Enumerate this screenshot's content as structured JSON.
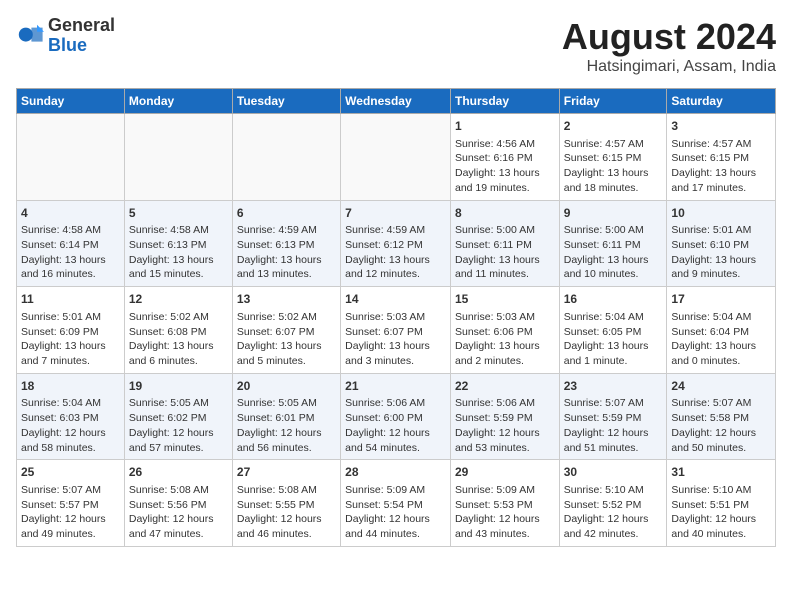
{
  "header": {
    "logo_general": "General",
    "logo_blue": "Blue",
    "title": "August 2024",
    "subtitle": "Hatsingimari, Assam, India"
  },
  "weekdays": [
    "Sunday",
    "Monday",
    "Tuesday",
    "Wednesday",
    "Thursday",
    "Friday",
    "Saturday"
  ],
  "weeks": [
    [
      {
        "day": "",
        "text": ""
      },
      {
        "day": "",
        "text": ""
      },
      {
        "day": "",
        "text": ""
      },
      {
        "day": "",
        "text": ""
      },
      {
        "day": "1",
        "text": "Sunrise: 4:56 AM\nSunset: 6:16 PM\nDaylight: 13 hours\nand 19 minutes."
      },
      {
        "day": "2",
        "text": "Sunrise: 4:57 AM\nSunset: 6:15 PM\nDaylight: 13 hours\nand 18 minutes."
      },
      {
        "day": "3",
        "text": "Sunrise: 4:57 AM\nSunset: 6:15 PM\nDaylight: 13 hours\nand 17 minutes."
      }
    ],
    [
      {
        "day": "4",
        "text": "Sunrise: 4:58 AM\nSunset: 6:14 PM\nDaylight: 13 hours\nand 16 minutes."
      },
      {
        "day": "5",
        "text": "Sunrise: 4:58 AM\nSunset: 6:13 PM\nDaylight: 13 hours\nand 15 minutes."
      },
      {
        "day": "6",
        "text": "Sunrise: 4:59 AM\nSunset: 6:13 PM\nDaylight: 13 hours\nand 13 minutes."
      },
      {
        "day": "7",
        "text": "Sunrise: 4:59 AM\nSunset: 6:12 PM\nDaylight: 13 hours\nand 12 minutes."
      },
      {
        "day": "8",
        "text": "Sunrise: 5:00 AM\nSunset: 6:11 PM\nDaylight: 13 hours\nand 11 minutes."
      },
      {
        "day": "9",
        "text": "Sunrise: 5:00 AM\nSunset: 6:11 PM\nDaylight: 13 hours\nand 10 minutes."
      },
      {
        "day": "10",
        "text": "Sunrise: 5:01 AM\nSunset: 6:10 PM\nDaylight: 13 hours\nand 9 minutes."
      }
    ],
    [
      {
        "day": "11",
        "text": "Sunrise: 5:01 AM\nSunset: 6:09 PM\nDaylight: 13 hours\nand 7 minutes."
      },
      {
        "day": "12",
        "text": "Sunrise: 5:02 AM\nSunset: 6:08 PM\nDaylight: 13 hours\nand 6 minutes."
      },
      {
        "day": "13",
        "text": "Sunrise: 5:02 AM\nSunset: 6:07 PM\nDaylight: 13 hours\nand 5 minutes."
      },
      {
        "day": "14",
        "text": "Sunrise: 5:03 AM\nSunset: 6:07 PM\nDaylight: 13 hours\nand 3 minutes."
      },
      {
        "day": "15",
        "text": "Sunrise: 5:03 AM\nSunset: 6:06 PM\nDaylight: 13 hours\nand 2 minutes."
      },
      {
        "day": "16",
        "text": "Sunrise: 5:04 AM\nSunset: 6:05 PM\nDaylight: 13 hours\nand 1 minute."
      },
      {
        "day": "17",
        "text": "Sunrise: 5:04 AM\nSunset: 6:04 PM\nDaylight: 13 hours\nand 0 minutes."
      }
    ],
    [
      {
        "day": "18",
        "text": "Sunrise: 5:04 AM\nSunset: 6:03 PM\nDaylight: 12 hours\nand 58 minutes."
      },
      {
        "day": "19",
        "text": "Sunrise: 5:05 AM\nSunset: 6:02 PM\nDaylight: 12 hours\nand 57 minutes."
      },
      {
        "day": "20",
        "text": "Sunrise: 5:05 AM\nSunset: 6:01 PM\nDaylight: 12 hours\nand 56 minutes."
      },
      {
        "day": "21",
        "text": "Sunrise: 5:06 AM\nSunset: 6:00 PM\nDaylight: 12 hours\nand 54 minutes."
      },
      {
        "day": "22",
        "text": "Sunrise: 5:06 AM\nSunset: 5:59 PM\nDaylight: 12 hours\nand 53 minutes."
      },
      {
        "day": "23",
        "text": "Sunrise: 5:07 AM\nSunset: 5:59 PM\nDaylight: 12 hours\nand 51 minutes."
      },
      {
        "day": "24",
        "text": "Sunrise: 5:07 AM\nSunset: 5:58 PM\nDaylight: 12 hours\nand 50 minutes."
      }
    ],
    [
      {
        "day": "25",
        "text": "Sunrise: 5:07 AM\nSunset: 5:57 PM\nDaylight: 12 hours\nand 49 minutes."
      },
      {
        "day": "26",
        "text": "Sunrise: 5:08 AM\nSunset: 5:56 PM\nDaylight: 12 hours\nand 47 minutes."
      },
      {
        "day": "27",
        "text": "Sunrise: 5:08 AM\nSunset: 5:55 PM\nDaylight: 12 hours\nand 46 minutes."
      },
      {
        "day": "28",
        "text": "Sunrise: 5:09 AM\nSunset: 5:54 PM\nDaylight: 12 hours\nand 44 minutes."
      },
      {
        "day": "29",
        "text": "Sunrise: 5:09 AM\nSunset: 5:53 PM\nDaylight: 12 hours\nand 43 minutes."
      },
      {
        "day": "30",
        "text": "Sunrise: 5:10 AM\nSunset: 5:52 PM\nDaylight: 12 hours\nand 42 minutes."
      },
      {
        "day": "31",
        "text": "Sunrise: 5:10 AM\nSunset: 5:51 PM\nDaylight: 12 hours\nand 40 minutes."
      }
    ]
  ]
}
